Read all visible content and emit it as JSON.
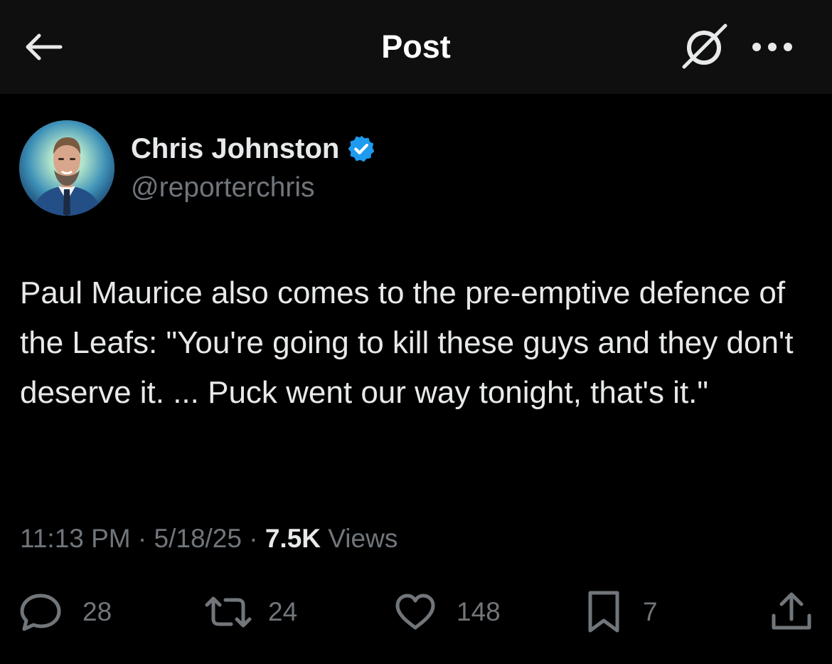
{
  "header": {
    "title": "Post",
    "back_icon": "back-arrow-icon",
    "grok_icon": "grok-icon",
    "more_icon": "more-icon"
  },
  "author": {
    "name": "Chris Johnston",
    "handle": "@reporterchris",
    "verified": true,
    "verified_color": "#1d9bf0"
  },
  "tweet": {
    "text": "Paul Maurice also comes to the pre-emptive defence of the Leafs: \"You're going to kill these guys and they don't deserve it. ... Puck went our way tonight, that's it.\"",
    "time": "11:13 PM",
    "date": "5/18/25",
    "separator": "·",
    "views_count": "7.5K",
    "views_label": "Views"
  },
  "actions": {
    "replies": "28",
    "reposts": "24",
    "likes": "148",
    "bookmarks": "7"
  },
  "colors": {
    "background": "#000000",
    "header_background": "#0f0f0f",
    "primary_text": "#e7e9ea",
    "secondary_text": "#71767b",
    "accent": "#1d9bf0"
  }
}
